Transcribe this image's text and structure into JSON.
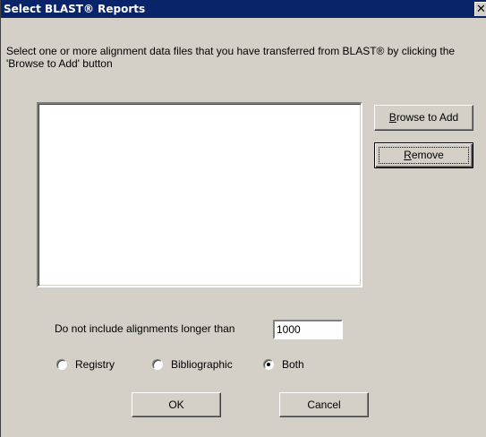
{
  "window": {
    "title": "Select BLAST® Reports",
    "close_glyph": "✕"
  },
  "instructions": "Select one or more alignment data files that you have transferred from BLAST® by clicking the 'Browse to Add' button",
  "file_list": {
    "items": []
  },
  "buttons": {
    "browse_add": {
      "underline": "B",
      "rest": "rowse to Add"
    },
    "remove": {
      "underline": "R",
      "rest": "emove"
    },
    "ok": "OK",
    "cancel": "Cancel"
  },
  "max_length": {
    "label": "Do not include alignments longer than",
    "value": "1000"
  },
  "search_scope": {
    "options": [
      "Registry",
      "Bibliographic",
      "Both"
    ],
    "selected": "Both"
  },
  "colors": {
    "titlebar": "#0a246a",
    "dialog_face": "#d4d0c8",
    "list_background": "#ffffff"
  },
  "icons": {
    "close": "close-icon"
  }
}
